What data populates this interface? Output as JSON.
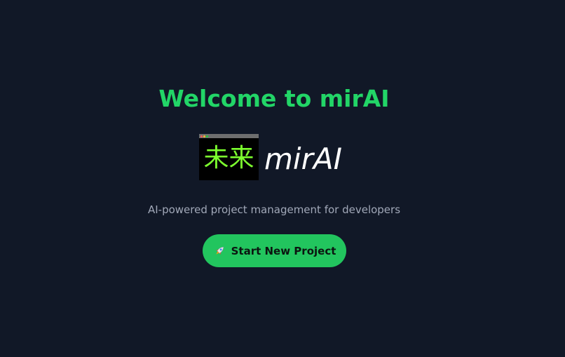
{
  "main": {
    "title": "Welcome to mirAI",
    "logo": {
      "kanji": "未来",
      "text": "mirAI"
    },
    "subtitle": "AI-powered project management for developers",
    "start_button": {
      "label": "Start New Project",
      "icon": "rocket-icon"
    }
  },
  "colors": {
    "background": "#111827",
    "accent": "#22c55e",
    "title": "#22d567",
    "subtitle": "#a1a8b8"
  }
}
